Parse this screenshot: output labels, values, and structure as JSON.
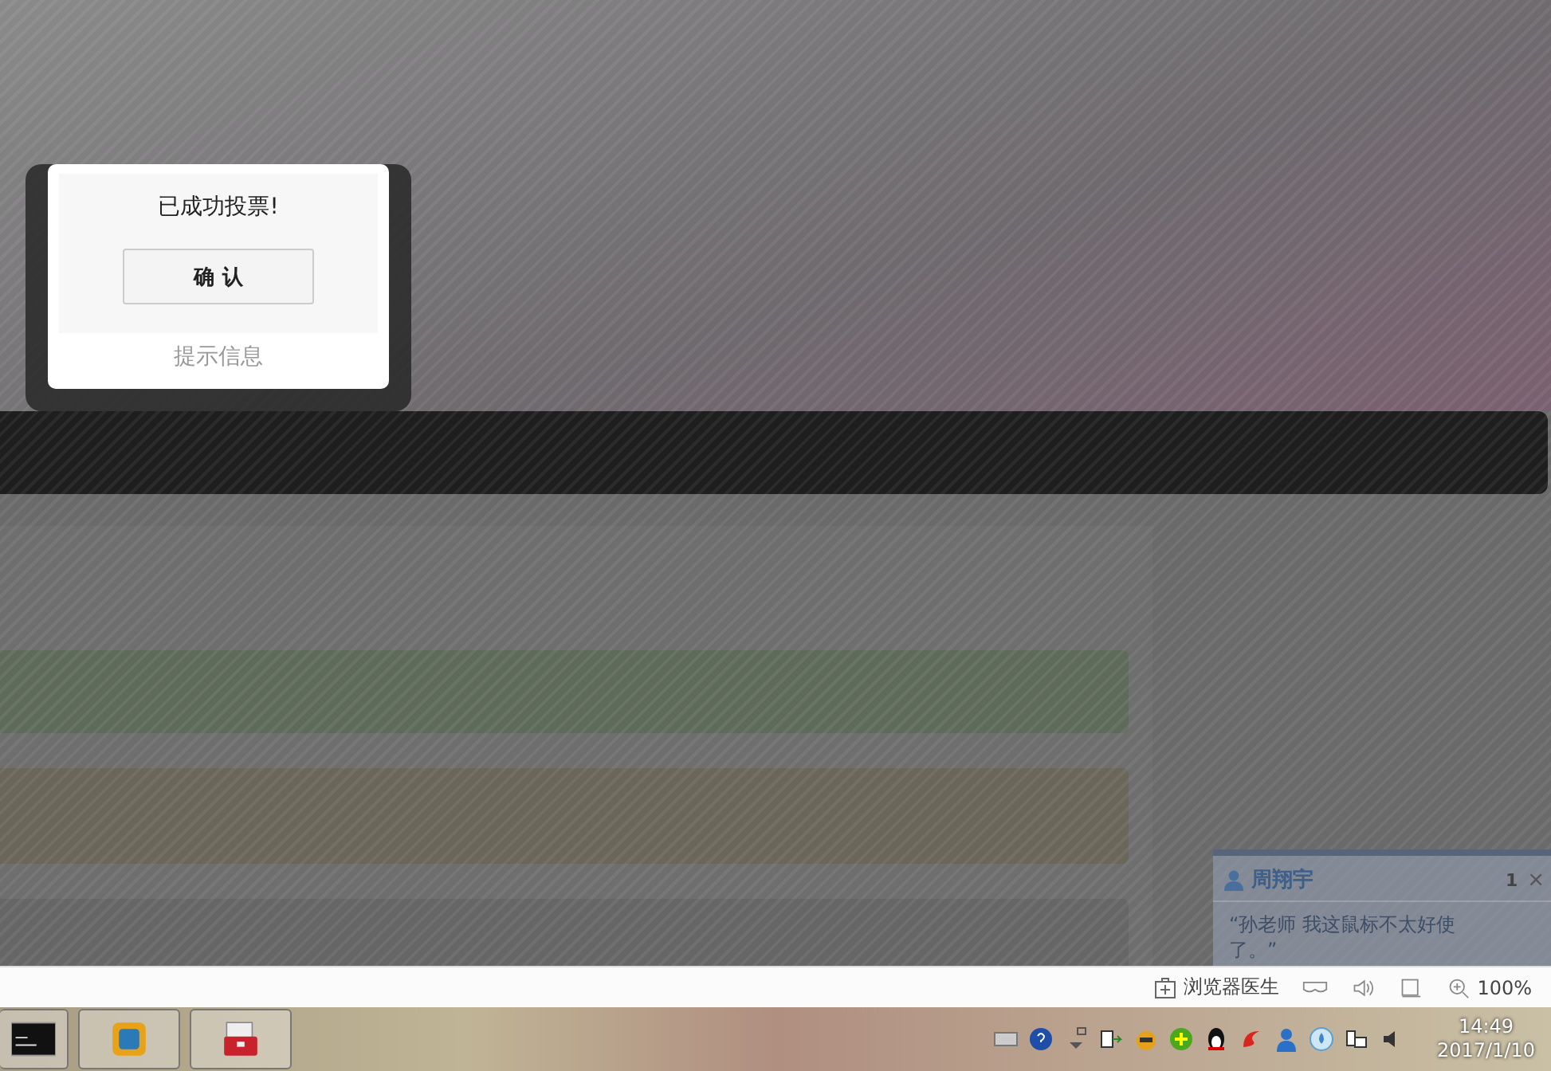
{
  "dialog": {
    "message": "已成功投票!",
    "button": "确 认",
    "caption": "提示信息"
  },
  "content_rows": [
    {
      "color": "#5f6b5a"
    },
    {
      "color": "#6b665a"
    },
    {
      "color": "#666666"
    }
  ],
  "status_bar": {
    "doctor": "浏览器医生",
    "zoom": "100%"
  },
  "notification": {
    "sender": "周翔宇",
    "count": "1",
    "close": "×",
    "message": "“孙老师  我这鼠标不太好使了。”"
  },
  "clock": {
    "time": "14:49",
    "date": "2017/1/10"
  }
}
